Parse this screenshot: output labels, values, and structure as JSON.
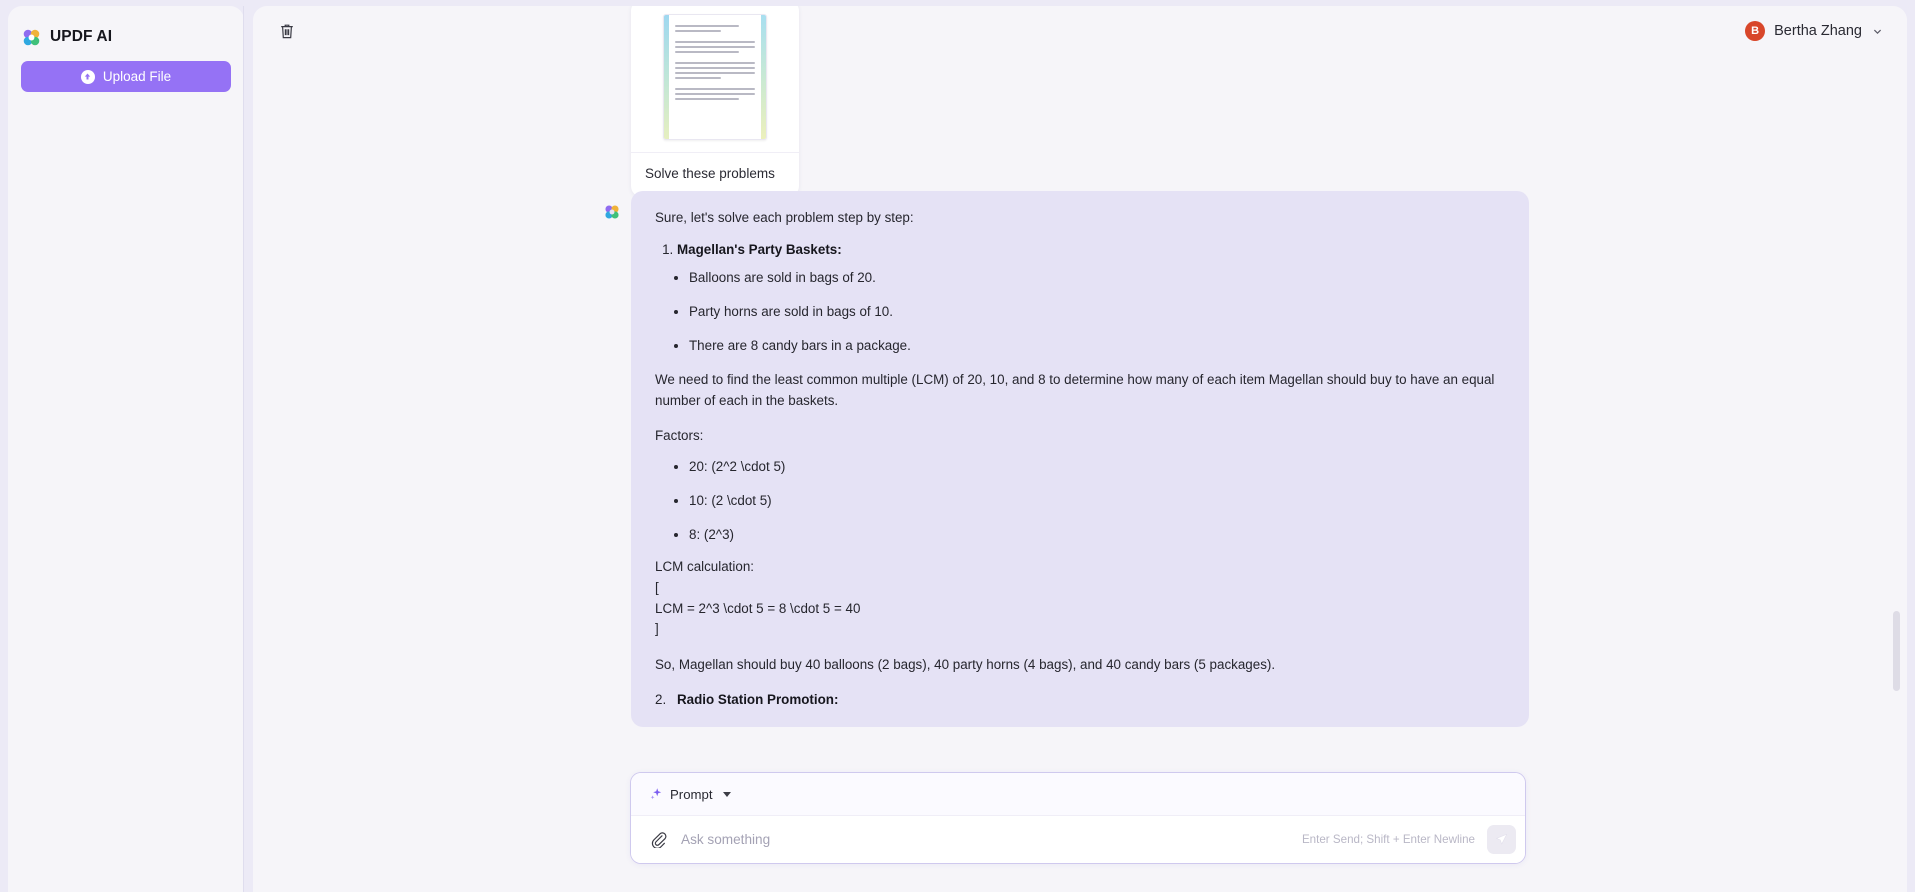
{
  "sidebar": {
    "brand": "UPDF AI",
    "brand_logo_icon": "updf-flower-logo",
    "upload_button": {
      "label": "Upload File",
      "icon": "upload-circle-icon"
    }
  },
  "header": {
    "trash_icon": "trash-icon",
    "user": {
      "name": "Bertha Zhang",
      "avatar_initial": "B",
      "avatar_color": "#d8462a",
      "chevron_icon": "chevron-down-icon"
    }
  },
  "conversation": {
    "user_message": {
      "attachment_type": "pdf-document-thumbnail",
      "text": "Solve these problems"
    },
    "assistant_message": {
      "logo_icon": "updf-flower-logo",
      "intro": "Sure, let's solve each problem step by step:",
      "items": [
        {
          "number": "1.",
          "title": "Magellan's Party Baskets:",
          "bullets": [
            "Balloons are sold in bags of 20.",
            "Party horns are sold in bags of 10.",
            "There are 8 candy bars in a package."
          ],
          "paragraph": "We need to find the least common multiple (LCM) of 20, 10, and 8 to determine how many of each item Magellan should buy to have an equal number of each in the baskets.",
          "factors_label": "Factors:",
          "factors": [
            "20: (2^2 \\cdot 5)",
            "10: (2 \\cdot 5)",
            "8: (2^3)"
          ],
          "calc_block": "LCM calculation:\n[\nLCM = 2^3 \\cdot 5 = 8 \\cdot 5 = 40\n]",
          "conclusion": "So, Magellan should buy 40 balloons (2 bags), 40 party horns (4 bags), and 40 candy bars (5 packages)."
        },
        {
          "number": "2.",
          "title": "Radio Station Promotion:"
        }
      ]
    }
  },
  "composer": {
    "prompt_selector": {
      "label": "Prompt",
      "icon": "sparkle-icon",
      "caret_icon": "caret-down-icon"
    },
    "attach_icon": "paperclip-icon",
    "input_placeholder": "Ask something",
    "input_value": "",
    "hint": "Enter Send; Shift + Enter Newline",
    "send_icon": "send-paper-plane-icon"
  },
  "colors": {
    "page_background": "#eceaf6",
    "panel_background": "#f6f5f9",
    "accent_purple": "#9572f5",
    "assistant_bubble": "#e5e2f5",
    "avatar_red": "#d8462a"
  }
}
